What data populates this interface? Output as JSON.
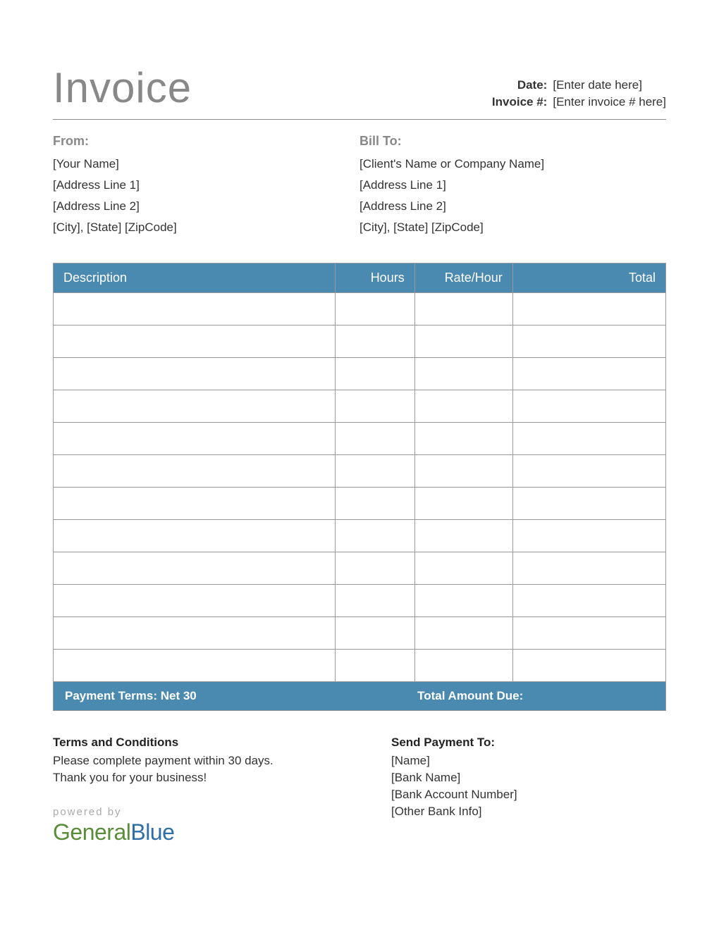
{
  "title": "Invoice",
  "meta": {
    "date_label": "Date:",
    "date_value": "[Enter date here]",
    "invoice_label": "Invoice #:",
    "invoice_value": "[Enter invoice # here]"
  },
  "from": {
    "heading": "From:",
    "lines": [
      "[Your Name]",
      "[Address Line 1]",
      "[Address Line 2]",
      "[City], [State] [ZipCode]"
    ]
  },
  "bill_to": {
    "heading": "Bill To:",
    "lines": [
      "[Client's Name or Company Name]",
      "[Address Line 1]",
      "[Address Line 2]",
      "[City], [State] [ZipCode]"
    ]
  },
  "table": {
    "headers": {
      "description": "Description",
      "hours": "Hours",
      "rate": "Rate/Hour",
      "total": "Total"
    },
    "rows": [
      {
        "description": "",
        "hours": "",
        "rate": "",
        "total": ""
      },
      {
        "description": "",
        "hours": "",
        "rate": "",
        "total": ""
      },
      {
        "description": "",
        "hours": "",
        "rate": "",
        "total": ""
      },
      {
        "description": "",
        "hours": "",
        "rate": "",
        "total": ""
      },
      {
        "description": "",
        "hours": "",
        "rate": "",
        "total": ""
      },
      {
        "description": "",
        "hours": "",
        "rate": "",
        "total": ""
      },
      {
        "description": "",
        "hours": "",
        "rate": "",
        "total": ""
      },
      {
        "description": "",
        "hours": "",
        "rate": "",
        "total": ""
      },
      {
        "description": "",
        "hours": "",
        "rate": "",
        "total": ""
      },
      {
        "description": "",
        "hours": "",
        "rate": "",
        "total": ""
      },
      {
        "description": "",
        "hours": "",
        "rate": "",
        "total": ""
      },
      {
        "description": "",
        "hours": "",
        "rate": "",
        "total": ""
      }
    ]
  },
  "footer_bar": {
    "payment_terms": "Payment Terms: Net 30",
    "total_due_label": "Total Amount Due:",
    "total_due_value": ""
  },
  "terms": {
    "heading": "Terms and Conditions",
    "lines": [
      "Please complete payment within 30 days.",
      "Thank you for your business!"
    ]
  },
  "send_payment": {
    "heading": "Send Payment To:",
    "lines": [
      "[Name]",
      "[Bank Name]",
      "[Bank Account Number]",
      "[Other Bank Info]"
    ]
  },
  "logo": {
    "powered": "powered by",
    "brand_first": "General",
    "brand_second": "Blue"
  }
}
